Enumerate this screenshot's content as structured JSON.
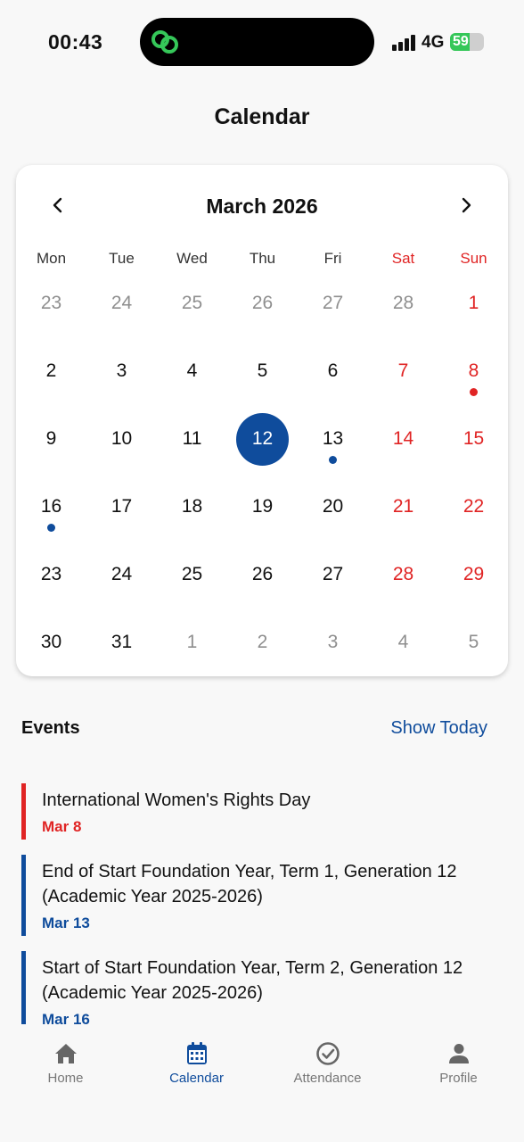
{
  "status": {
    "time": "00:43",
    "network": "4G",
    "battery": "59",
    "battery_level": 0.59
  },
  "header": {
    "title": "Calendar"
  },
  "calendar": {
    "month_label": "March 2026",
    "weekdays": [
      "Mon",
      "Tue",
      "Wed",
      "Thu",
      "Fri",
      "Sat",
      "Sun"
    ],
    "days": [
      {
        "d": "23",
        "muted": true
      },
      {
        "d": "24",
        "muted": true
      },
      {
        "d": "25",
        "muted": true
      },
      {
        "d": "26",
        "muted": true
      },
      {
        "d": "27",
        "muted": true
      },
      {
        "d": "28",
        "muted": true
      },
      {
        "d": "1"
      },
      {
        "d": "2"
      },
      {
        "d": "3"
      },
      {
        "d": "4"
      },
      {
        "d": "5"
      },
      {
        "d": "6"
      },
      {
        "d": "7"
      },
      {
        "d": "8",
        "dot": "#e02424"
      },
      {
        "d": "9"
      },
      {
        "d": "10"
      },
      {
        "d": "11"
      },
      {
        "d": "12",
        "selected": true
      },
      {
        "d": "13",
        "dot": "#0f4c9c"
      },
      {
        "d": "14"
      },
      {
        "d": "15"
      },
      {
        "d": "16",
        "dot": "#0f4c9c"
      },
      {
        "d": "17"
      },
      {
        "d": "18"
      },
      {
        "d": "19"
      },
      {
        "d": "20"
      },
      {
        "d": "21"
      },
      {
        "d": "22"
      },
      {
        "d": "23"
      },
      {
        "d": "24"
      },
      {
        "d": "25"
      },
      {
        "d": "26"
      },
      {
        "d": "27"
      },
      {
        "d": "28"
      },
      {
        "d": "29"
      },
      {
        "d": "30"
      },
      {
        "d": "31"
      },
      {
        "d": "1",
        "muted": true
      },
      {
        "d": "2",
        "muted": true
      },
      {
        "d": "3",
        "muted": true
      },
      {
        "d": "4",
        "muted": true
      },
      {
        "d": "5",
        "muted": true
      }
    ]
  },
  "events": {
    "title": "Events",
    "show_today": "Show Today",
    "items": [
      {
        "title": "International Women's Rights Day",
        "date": "Mar 8",
        "color": "#e02424"
      },
      {
        "title": "End of Start Foundation Year, Term 1, Generation 12 (Academic Year 2025-2026)",
        "date": "Mar 13",
        "color": "#0f4c9c"
      },
      {
        "title": "Start of Start Foundation Year, Term 2, Generation 12 (Academic Year 2025-2026)",
        "date": "Mar 16",
        "color": "#0f4c9c"
      }
    ]
  },
  "tabs": [
    {
      "label": "Home",
      "icon": "home-icon",
      "active": false
    },
    {
      "label": "Calendar",
      "icon": "calendar-icon",
      "active": true
    },
    {
      "label": "Attendance",
      "icon": "check-circle-icon",
      "active": false
    },
    {
      "label": "Profile",
      "icon": "person-icon",
      "active": false
    }
  ],
  "colors": {
    "accent": "#0f4c9c",
    "weekend": "#e02424",
    "muted": "#8f8f8f"
  }
}
